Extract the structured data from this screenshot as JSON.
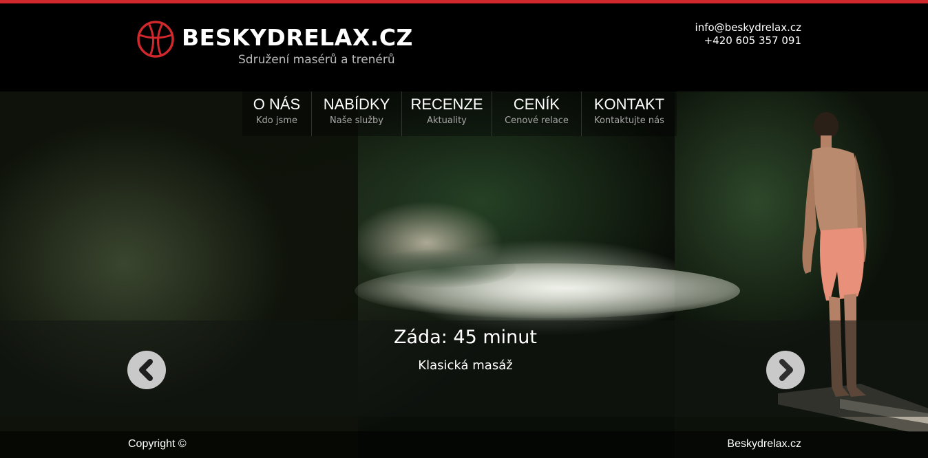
{
  "header": {
    "brand": "BESKYDRELAX.CZ",
    "tagline": "Sdružení masérů a trenérů",
    "email": "info@beskydrelax.cz",
    "phone": "+420 605 357 091",
    "accent_color": "#d0282c"
  },
  "nav": {
    "items": [
      {
        "title": "O NÁS",
        "subtitle": "Kdo jsme"
      },
      {
        "title": "NABÍDKY",
        "subtitle": "Naše služby"
      },
      {
        "title": "RECENZE",
        "subtitle": "Aktuality"
      },
      {
        "title": "CENÍK",
        "subtitle": "Cenové relace"
      },
      {
        "title": "KONTAKT",
        "subtitle": "Kontaktujte nás"
      }
    ]
  },
  "slider": {
    "title": "Záda: 45 minut",
    "subtitle": "Klasická masáž",
    "prev_icon": "chevron-left-icon",
    "next_icon": "chevron-right-icon"
  },
  "footer": {
    "copyright": "Copyright ©",
    "site_name": "Beskydrelax.cz"
  }
}
